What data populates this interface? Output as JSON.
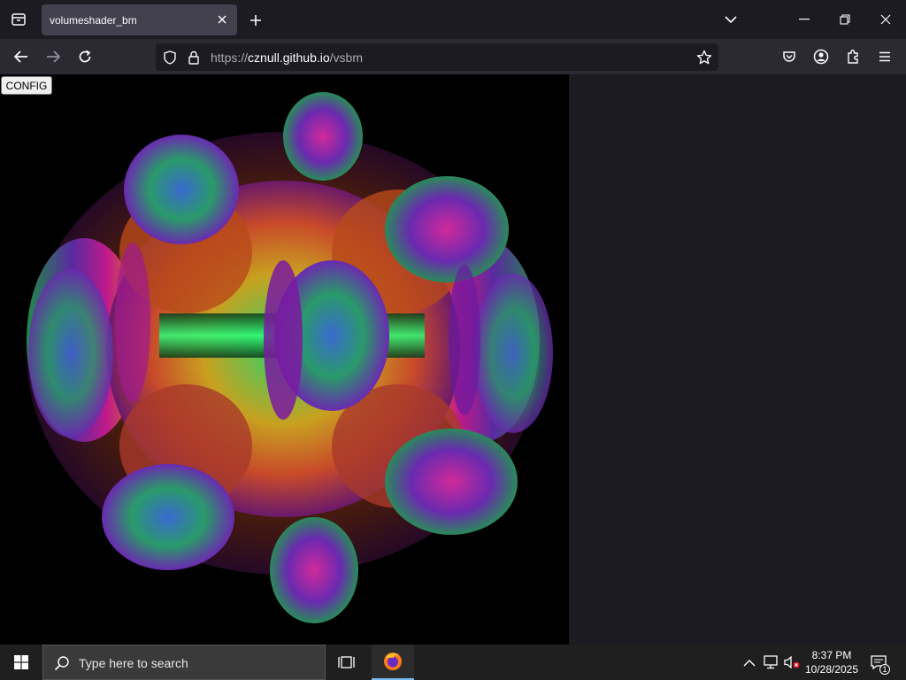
{
  "browser": {
    "tab_title": "volumeshader_bm",
    "url_prefix": "https://",
    "url_host": "cznull.github.io",
    "url_path": "/vsbm"
  },
  "page": {
    "config_label": "CONFIG",
    "canvas_background": "#000000"
  },
  "taskbar": {
    "search_placeholder": "Type here to search",
    "time": "8:37 PM",
    "date": "10/28/2025",
    "notification_count": "1"
  },
  "icons": [
    "tab-overview-icon",
    "close-icon",
    "plus-icon",
    "chevron-down-icon",
    "minimize-icon",
    "restore-icon",
    "window-close-icon",
    "back-arrow-icon",
    "forward-arrow-icon",
    "reload-icon",
    "shield-icon",
    "lock-icon",
    "star-icon",
    "pocket-icon",
    "account-icon",
    "extensions-icon",
    "menu-icon",
    "windows-logo-icon",
    "search-icon",
    "task-view-icon",
    "firefox-icon",
    "chevron-up-icon",
    "network-icon",
    "volume-muted-icon",
    "notification-icon"
  ],
  "colors": {
    "accent": "#76b9ed",
    "tab_active": "#42414d",
    "toolbar": "#2b2a33",
    "frame": "#1c1b22"
  }
}
